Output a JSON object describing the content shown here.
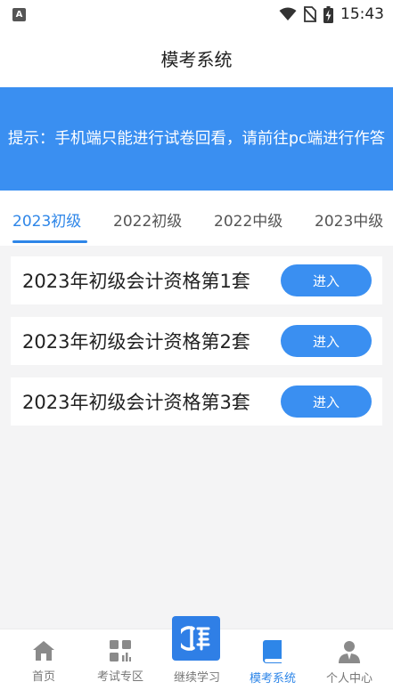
{
  "status_bar": {
    "time": "15:43",
    "app_letter": "A"
  },
  "header": {
    "title": "模考系统"
  },
  "notice": {
    "text": "提示：手机端只能进行试卷回看，请前往pc端进行作答"
  },
  "tabs": [
    {
      "label": "2023初级",
      "active": true
    },
    {
      "label": "2022初级",
      "active": false
    },
    {
      "label": "2022中级",
      "active": false
    },
    {
      "label": "2023中级",
      "active": false
    }
  ],
  "exams": [
    {
      "title": "2023年初级会计资格第1套",
      "button": "进入"
    },
    {
      "title": "2023年初级会计资格第2套",
      "button": "进入"
    },
    {
      "title": "2023年初级会计资格第3套",
      "button": "进入"
    }
  ],
  "bottom_nav": {
    "home": "首页",
    "exam_zone": "考试专区",
    "continue_study": "继续学习",
    "mock_system": "模考系统",
    "profile": "个人中心"
  },
  "colors": {
    "accent": "#3a8ff1",
    "active_tab": "#2e86e8"
  }
}
